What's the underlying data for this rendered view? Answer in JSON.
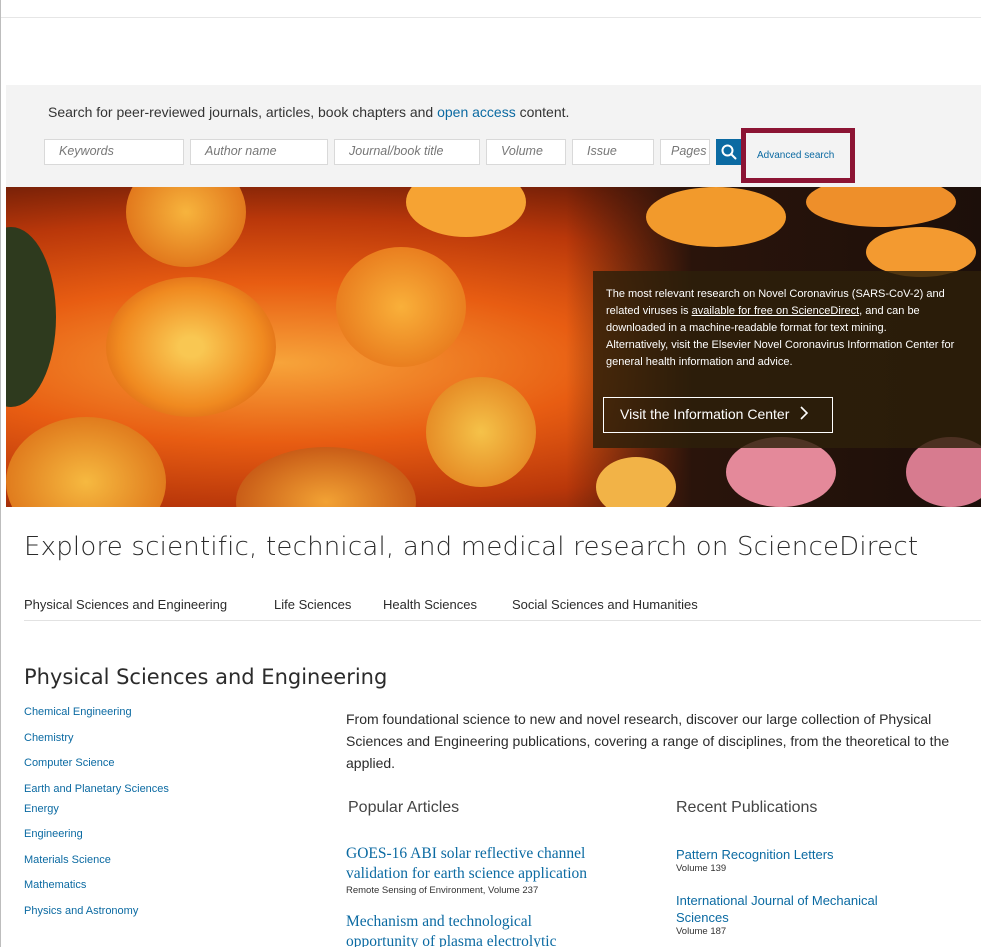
{
  "search": {
    "tagline_prefix": "Search for peer-reviewed journals, articles, book chapters and ",
    "tagline_link": "open access",
    "tagline_suffix": " content.",
    "fields": {
      "keywords": "Keywords",
      "author": "Author name",
      "journal": "Journal/book title",
      "volume": "Volume",
      "issue": "Issue",
      "pages": "Pages"
    },
    "search_icon": "search-icon",
    "advanced_label": "Advanced search",
    "highlight_color": "#8c1434"
  },
  "hero": {
    "text_1": "The most relevant research on Novel Coronavirus (SARS-CoV-2) and\nrelated viruses is ",
    "text_link": "available for free on ScienceDirect",
    "text_2": ", and can be\ndownloaded in a machine-readable format for text mining.\nAlternatively, visit the Elsevier Novel Coronavirus Information Center for\ngeneral health information and advice.",
    "button_label": "Visit the Information Center",
    "button_icon": "chevron-right-icon"
  },
  "explore": {
    "title": "Explore scientific, technical, and medical research on ScienceDirect",
    "tabs": [
      "Physical Sciences and Engineering",
      "Life Sciences",
      "Health Sciences",
      "Social Sciences and Humanities"
    ]
  },
  "section": {
    "title": "Physical Sciences and Engineering",
    "subjects": [
      "Chemical Engineering",
      "Chemistry",
      "Computer Science",
      "Earth and Planetary Sciences",
      "Energy",
      "Engineering",
      "Materials Science",
      "Mathematics",
      "Physics and Astronomy"
    ],
    "intro": "From foundational science to new and novel research, discover our large collection of Physical\nSciences and Engineering publications, covering a range of disciplines, from the theoretical to the\napplied.",
    "popular_heading": "Popular Articles",
    "recent_heading": "Recent Publications",
    "popular": [
      {
        "title": "GOES-16 ABI solar reflective channel\nvalidation for earth science application",
        "meta": "Remote Sensing of Environment, Volume 237"
      },
      {
        "title": "Mechanism and technological\nopportunity of plasma electrolytic",
        "meta": ""
      }
    ],
    "recent": [
      {
        "title": "Pattern Recognition Letters",
        "meta": "Volume 139"
      },
      {
        "title": "International Journal of Mechanical\nSciences",
        "meta": "Volume 187"
      }
    ]
  }
}
